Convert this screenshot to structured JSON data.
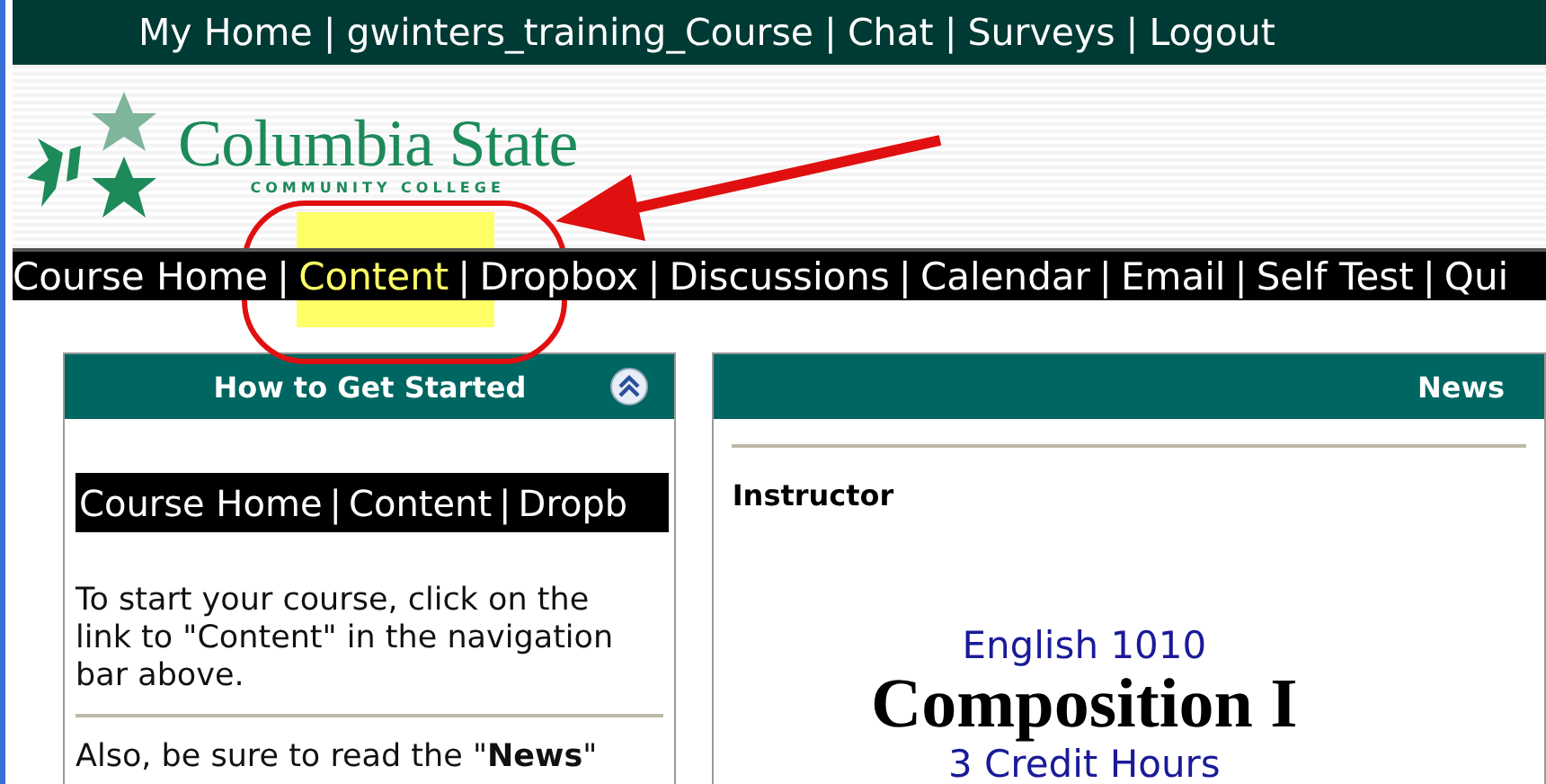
{
  "top_links": {
    "separator": "|",
    "items": [
      "My Home",
      "gwinters_training_Course",
      "Chat",
      "Surveys",
      "Logout"
    ]
  },
  "logo": {
    "name": "Columbia State",
    "tagline": "COMMUNITY COLLEGE"
  },
  "nav": {
    "separator": "|",
    "items": [
      {
        "label": "Course Home",
        "selected": false
      },
      {
        "label": "Content",
        "selected": true
      },
      {
        "label": "Dropbox",
        "selected": false
      },
      {
        "label": "Discussions",
        "selected": false
      },
      {
        "label": "Calendar",
        "selected": false
      },
      {
        "label": "Email",
        "selected": false
      },
      {
        "label": "Self Test",
        "selected": false
      },
      {
        "label": "Qui",
        "selected": false
      }
    ]
  },
  "left_panel": {
    "title": "How to Get Started",
    "expanded": true,
    "nav_image": {
      "separator": "|",
      "items": [
        "Course Home",
        "Content",
        "Dropb"
      ]
    },
    "paragraphs": [
      "To start your course, click on the link to \"Content\" in the navigation bar above.",
      "Also, be sure to read the \"**News**\""
    ]
  },
  "right_panel": {
    "title": "News",
    "heading": "Instructor",
    "course_code": "English 1010",
    "course_title": "Composition I",
    "credits": "3 Credit Hours"
  }
}
